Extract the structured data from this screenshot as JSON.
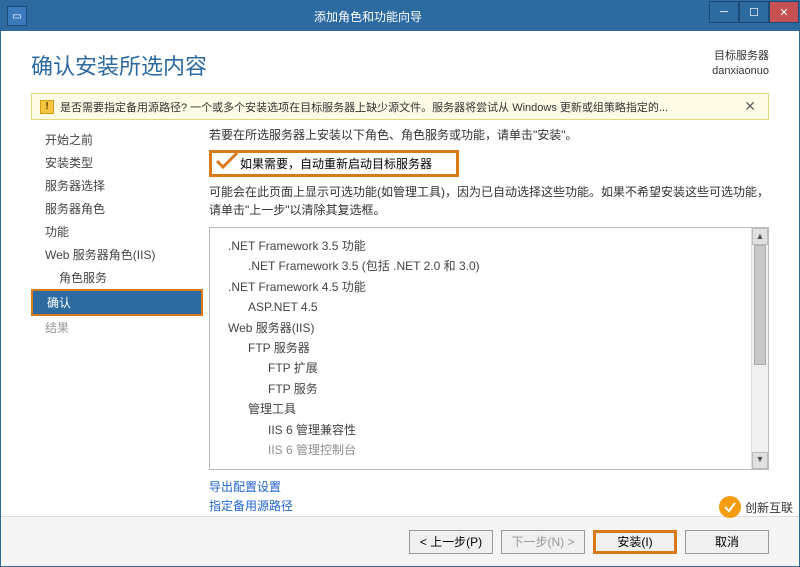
{
  "titlebar": {
    "title": "添加角色和功能向导"
  },
  "header": {
    "page_title": "确认安装所选内容",
    "target_label": "目标服务器",
    "target_name": "danxiaonuo"
  },
  "warning": {
    "text": "是否需要指定备用源路径? 一个或多个安装选项在目标服务器上缺少源文件。服务器将尝试从 Windows 更新或组策略指定的..."
  },
  "sidebar": {
    "items": [
      {
        "label": "开始之前",
        "key": "before"
      },
      {
        "label": "安装类型",
        "key": "type"
      },
      {
        "label": "服务器选择",
        "key": "svrsel"
      },
      {
        "label": "服务器角色",
        "key": "roles"
      },
      {
        "label": "功能",
        "key": "features"
      },
      {
        "label": "Web 服务器角色(IIS)",
        "key": "iis"
      },
      {
        "label": "角色服务",
        "key": "rolesvc",
        "indent": true
      },
      {
        "label": "确认",
        "key": "confirm",
        "active": true
      },
      {
        "label": "结果",
        "key": "result",
        "disabled": true
      }
    ]
  },
  "main": {
    "instruction": "若要在所选服务器上安装以下角色、角色服务或功能，请单击\"安装\"。",
    "checkbox_label": "如果需要，自动重新启动目标服务器",
    "note": "可能会在此页面上显示可选功能(如管理工具)，因为已自动选择这些功能。如果不希望安装这些可选功能，请单击\"上一步\"以清除其复选框。",
    "features": [
      {
        "level": 1,
        "text": ".NET Framework 3.5 功能"
      },
      {
        "level": 2,
        "text": ".NET Framework 3.5 (包括 .NET 2.0 和 3.0)"
      },
      {
        "level": 1,
        "text": ".NET Framework 4.5 功能"
      },
      {
        "level": 2,
        "text": "ASP.NET 4.5"
      },
      {
        "level": 1,
        "text": "Web 服务器(IIS)"
      },
      {
        "level": 2,
        "text": "FTP 服务器"
      },
      {
        "level": 3,
        "text": "FTP 扩展"
      },
      {
        "level": 3,
        "text": "FTP 服务"
      },
      {
        "level": 2,
        "text": "管理工具"
      },
      {
        "level": 3,
        "text": "IIS 6 管理兼容性"
      },
      {
        "level": 3,
        "text": "IIS 6 管理控制台"
      }
    ],
    "links": {
      "export": "导出配置设置",
      "altpath": "指定备用源路径"
    }
  },
  "footer": {
    "prev": "< 上一步(P)",
    "next": "下一步(N) >",
    "install": "安装(I)",
    "cancel": "取消"
  },
  "watermark": "创新互联"
}
